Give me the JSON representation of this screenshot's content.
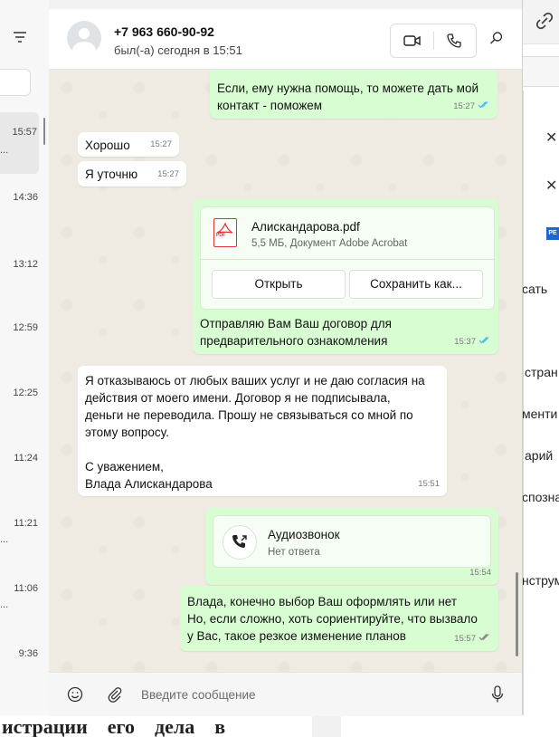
{
  "contact": {
    "name": "+7 963 660-90-92",
    "status": "был(-а) сегодня в 15:51"
  },
  "chat_list_times": [
    "15:57",
    "14:36",
    "13:12",
    "12:59",
    "12:25",
    "11:24",
    "11:21",
    "11:06",
    "9:36"
  ],
  "chat_list_dots": "...",
  "messages": [
    {
      "dir": "out",
      "text": "Если, ему нужна помощь, то можете дать мой\nконтакт - поможем",
      "time": "15:27",
      "read": true
    },
    {
      "dir": "in",
      "text": "Хорошо",
      "time": "15:27"
    },
    {
      "dir": "in",
      "text": "Я уточню",
      "time": "15:27"
    },
    {
      "dir": "out",
      "type": "file",
      "file_name": "Алискандарова.pdf",
      "file_meta": "5,5 МБ, Документ Adobe Acrobat",
      "open_label": "Открыть",
      "save_label": "Сохранить как...",
      "text": "Отправляю Вам Ваш договор для\nпредварительного ознакомления",
      "time": "15:37",
      "read": true
    },
    {
      "dir": "in",
      "text": "Я отказываюсь от любых ваших услуг и не даю согласия на\nдействия от моего имени. Договор я не подписывала,\nденьги не переводила. Прошу не связываться со мной по\nэтому вопросу.\n\nС уважением,\nВлада Алискандарова",
      "time": "15:51"
    },
    {
      "dir": "out",
      "type": "call",
      "call_title": "Аудиозвонок",
      "call_sub": "Нет ответа",
      "time": "15:54"
    },
    {
      "dir": "out",
      "text": "Влада, конечно выбор Ваш оформлять или нет\nНо, если сложно, хоть сориентируйте, что вызвало\nу Вас, такое резкое изменение планов",
      "time": "15:57",
      "read": false
    }
  ],
  "composer": {
    "placeholder": "Введите сообщение"
  },
  "background_doc": {
    "fragments": [
      "сать",
      "стран",
      "менти",
      "арий",
      "спозна",
      "нструм"
    ],
    "tag": "РЕ",
    "bottom_words": [
      "истрации",
      "его",
      "дела",
      "в"
    ]
  },
  "colors": {
    "outgoing": "#d9fdd3",
    "incoming": "#ffffff",
    "read_tick": "#53bdeb",
    "chat_bg": "#efeae2"
  }
}
